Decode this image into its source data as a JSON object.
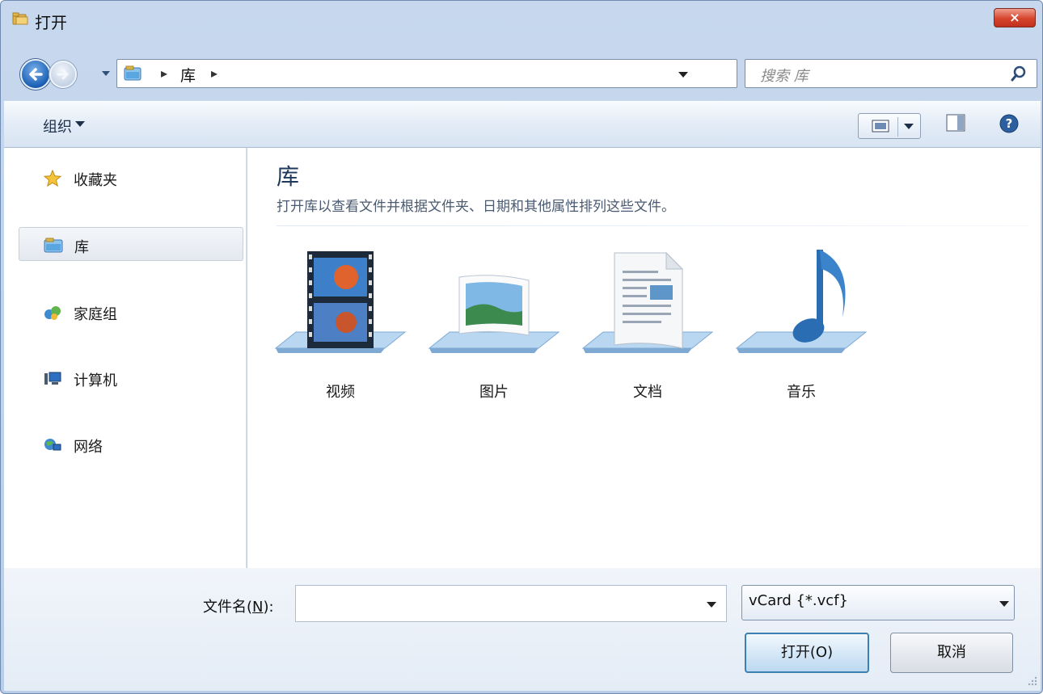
{
  "window": {
    "title": "打开",
    "close_label": "×"
  },
  "nav": {
    "breadcrumb": [
      "库"
    ],
    "search_placeholder": "搜索 库",
    "refresh_glyph": "↺"
  },
  "toolbar": {
    "organize_label": "组织"
  },
  "sidebar": {
    "items": [
      {
        "label": "收藏夹",
        "icon": "star-icon"
      },
      {
        "label": "库",
        "icon": "library-icon",
        "selected": true
      },
      {
        "label": "家庭组",
        "icon": "homegroup-icon"
      },
      {
        "label": "计算机",
        "icon": "computer-icon"
      },
      {
        "label": "网络",
        "icon": "network-icon"
      }
    ]
  },
  "content": {
    "title": "库",
    "description": "打开库以查看文件并根据文件夹、日期和其他属性排列这些文件。",
    "libraries": [
      {
        "label": "视频",
        "icon": "video-library-icon"
      },
      {
        "label": "图片",
        "icon": "pictures-library-icon"
      },
      {
        "label": "文档",
        "icon": "documents-library-icon"
      },
      {
        "label": "音乐",
        "icon": "music-library-icon"
      }
    ]
  },
  "footer": {
    "filename_label": "文件名(",
    "filename_mnemonic": "N",
    "filename_label_end": "):",
    "filename_value": "",
    "filetype_value": "vCard {*.vcf}",
    "open_label": "打开(O)",
    "cancel_label": "取消"
  },
  "colors": {
    "accent": "#1a5fb4",
    "frame": "#b9cde8",
    "title_text": "#1e395b"
  }
}
